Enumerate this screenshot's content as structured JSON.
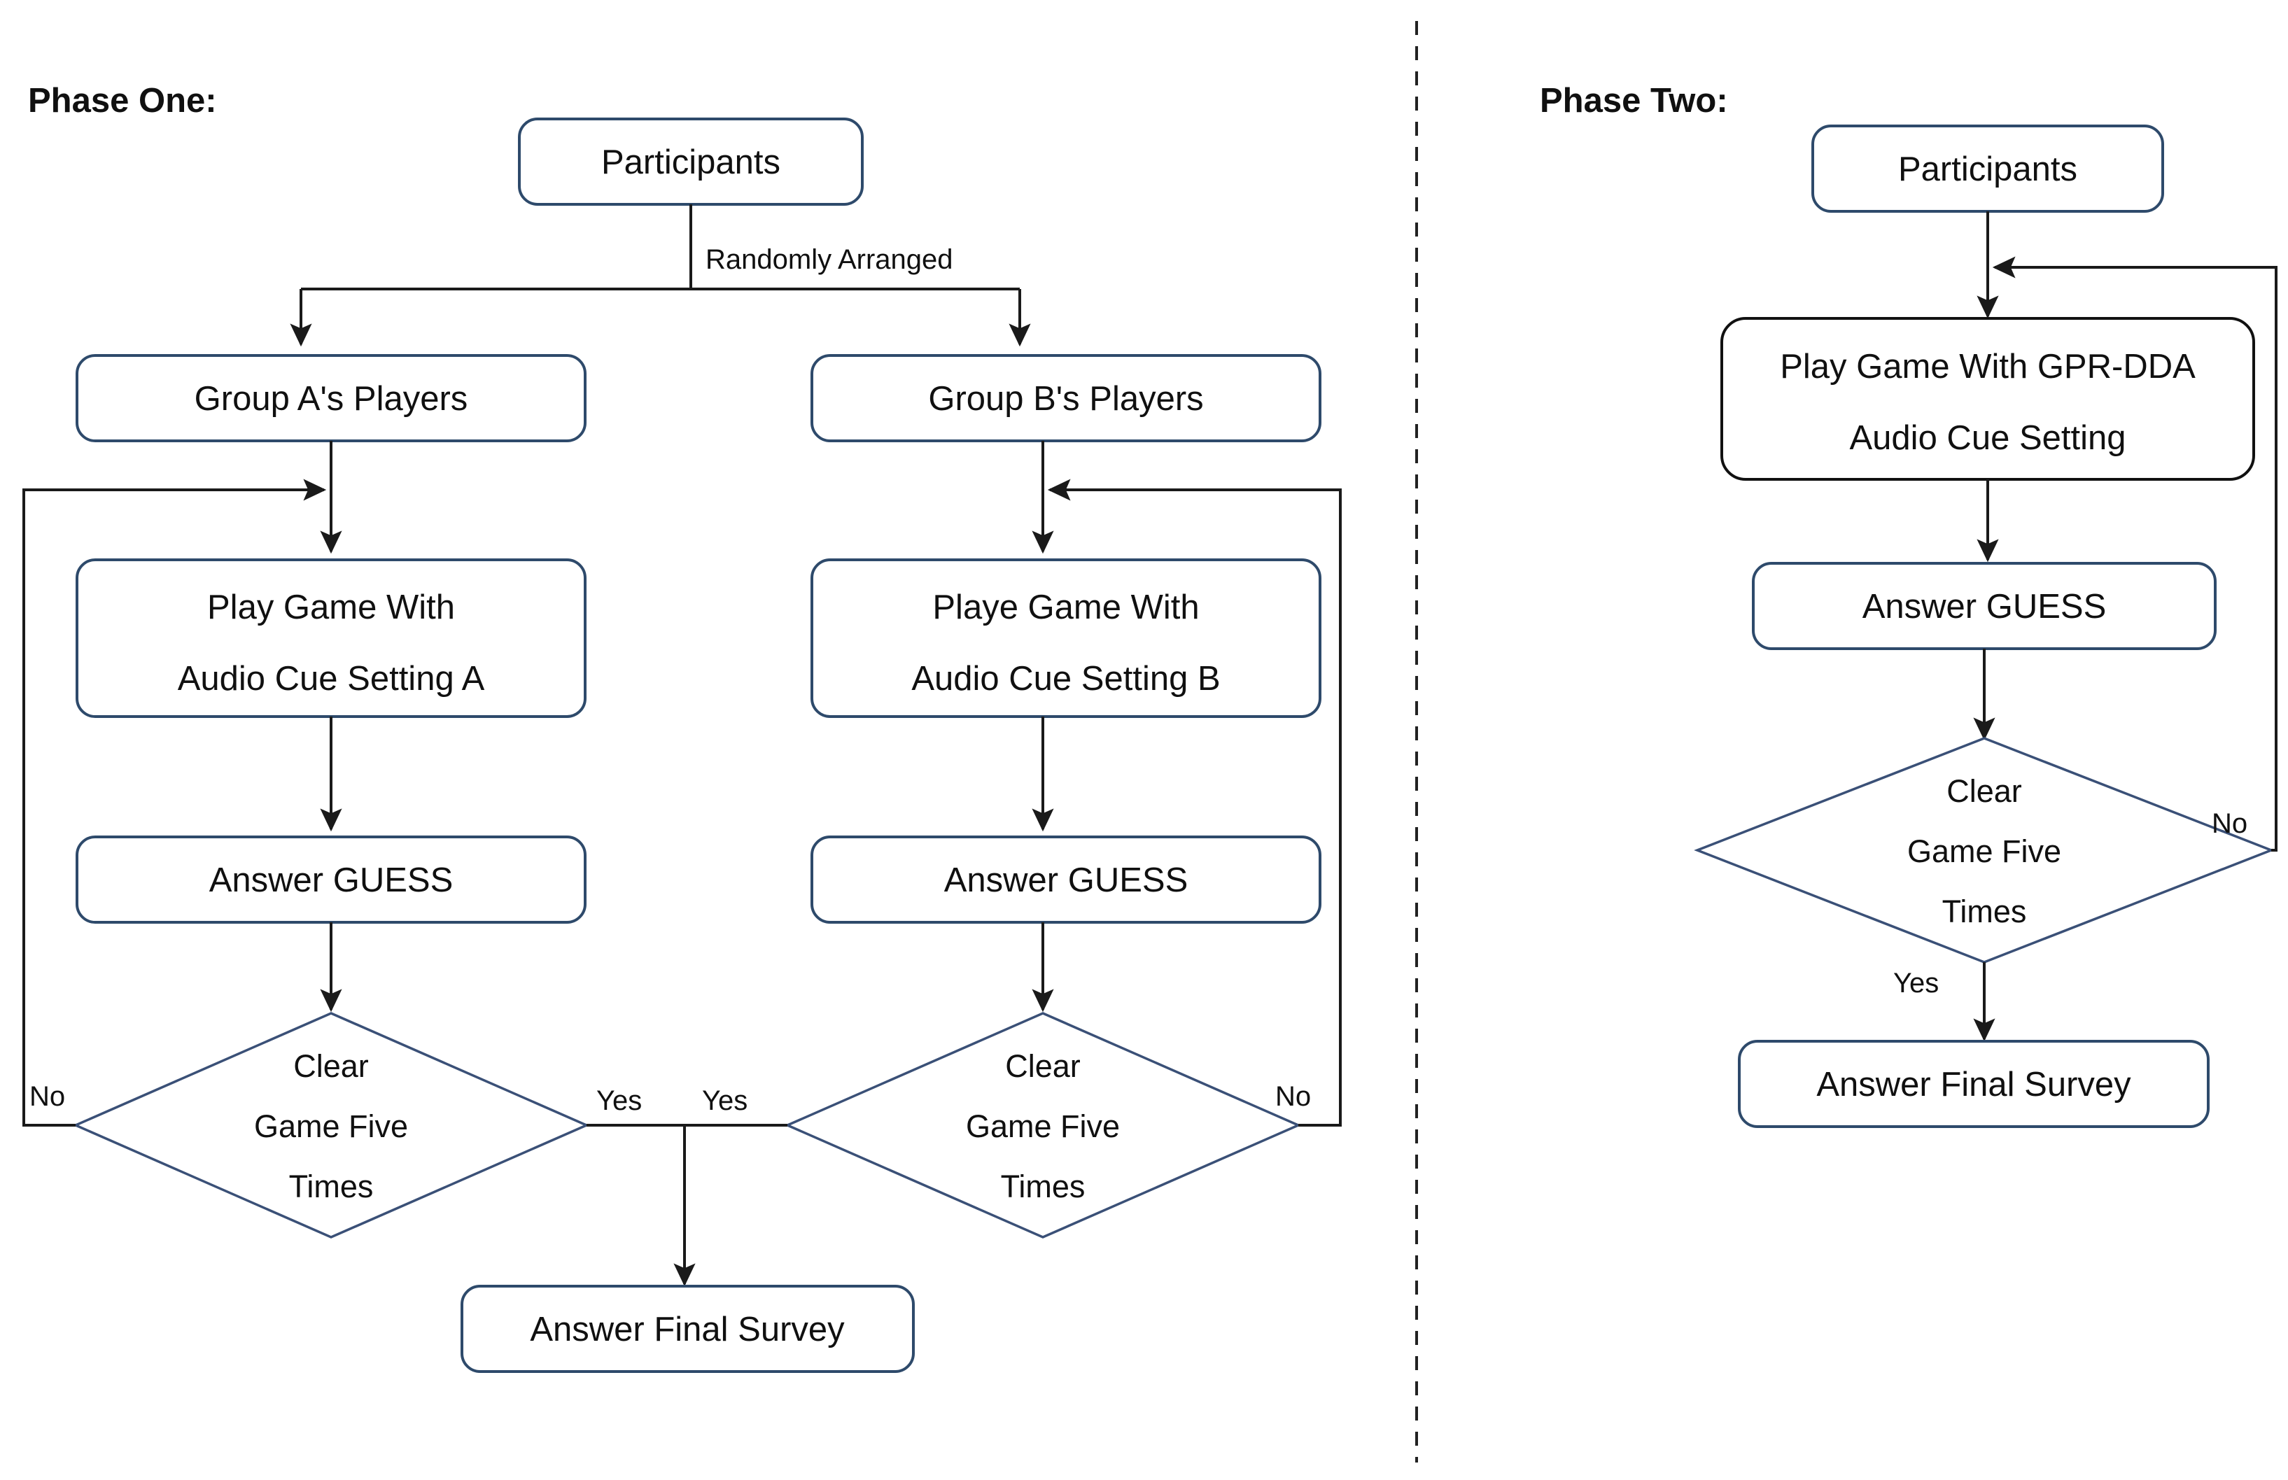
{
  "diagram": {
    "title_phase_one": "Phase One:",
    "title_phase_two": "Phase Two:",
    "colors": {
      "box_stroke_navy": "#2e4a6b",
      "box_stroke_black": "#111111",
      "diamond_stroke": "#3a5077",
      "edge": "#1a1a1a",
      "divider": "#222222",
      "text": "#101010",
      "background": "#ffffff"
    }
  },
  "phase_one": {
    "heading": "Phase One:",
    "nodes": {
      "participants": "Participants",
      "group_a": "Group A's Players",
      "group_b": "Group B's Players",
      "play_a_line1": "Play Game With",
      "play_a_line2": "Audio Cue Setting A",
      "play_b_line1": "Playe Game With",
      "play_b_line2": "Audio Cue Setting B",
      "answer_guess_a": "Answer GUESS",
      "answer_guess_b": "Answer GUESS",
      "decision_a_line1": "Clear",
      "decision_a_line2": "Game Five",
      "decision_a_line3": "Times",
      "decision_b_line1": "Clear",
      "decision_b_line2": "Game Five",
      "decision_b_line3": "Times",
      "final_survey": "Answer Final Survey"
    },
    "edge_labels": {
      "randomly_arranged": "Randomly Arranged",
      "no_left": "No",
      "yes_left": "Yes",
      "yes_right": "Yes",
      "no_right": "No"
    }
  },
  "phase_two": {
    "heading": "Phase Two:",
    "nodes": {
      "participants": "Participants",
      "play_gpr_line1": "Play Game With GPR-DDA",
      "play_gpr_line2": "Audio Cue Setting",
      "answer_guess": "Answer GUESS",
      "decision_line1": "Clear",
      "decision_line2": "Game Five",
      "decision_line3": "Times",
      "final_survey": "Answer Final Survey"
    },
    "edge_labels": {
      "no": "No",
      "yes": "Yes"
    }
  }
}
